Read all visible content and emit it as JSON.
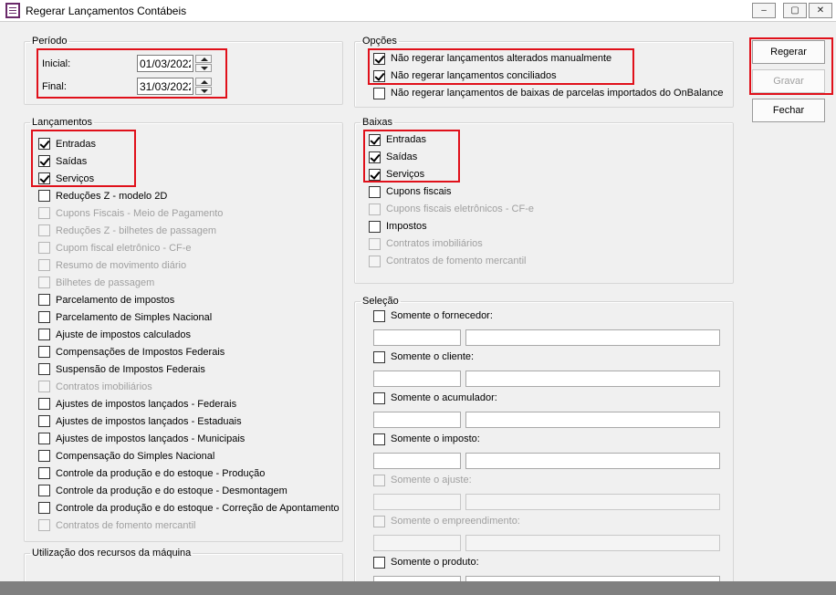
{
  "window": {
    "title": "Regerar Lançamentos Contábeis",
    "controls": {
      "minimize": "‒",
      "restore": "▢",
      "close": "✕"
    }
  },
  "buttons": {
    "regerar": "Regerar",
    "gravar": "Gravar",
    "fechar": "Fechar"
  },
  "periodo": {
    "legend": "Período",
    "inicial_label": "Inicial:",
    "inicial_value": "01/03/2022",
    "final_label": "Final:",
    "final_value": "31/03/2022"
  },
  "opcoes": {
    "legend": "Opções",
    "items": [
      {
        "label": "Não regerar lançamentos alterados manualmente",
        "checked": true,
        "enabled": true
      },
      {
        "label": "Não regerar lançamentos conciliados",
        "checked": true,
        "enabled": true
      },
      {
        "label": "Não regerar lançamentos de baixas de parcelas importados do OnBalance",
        "checked": false,
        "enabled": true
      }
    ]
  },
  "lancamentos": {
    "legend": "Lançamentos",
    "items": [
      {
        "label": "Entradas",
        "checked": true,
        "enabled": true
      },
      {
        "label": "Saídas",
        "checked": true,
        "enabled": true
      },
      {
        "label": "Serviços",
        "checked": true,
        "enabled": true
      },
      {
        "label": "Reduções Z - modelo 2D",
        "checked": false,
        "enabled": true
      },
      {
        "label": "Cupons Fiscais - Meio de Pagamento",
        "checked": false,
        "enabled": false
      },
      {
        "label": "Reduções Z - bilhetes de passagem",
        "checked": false,
        "enabled": false
      },
      {
        "label": "Cupom fiscal eletrônico - CF-e",
        "checked": false,
        "enabled": false
      },
      {
        "label": "Resumo de movimento diário",
        "checked": false,
        "enabled": false
      },
      {
        "label": "Bilhetes de passagem",
        "checked": false,
        "enabled": false
      },
      {
        "label": "Parcelamento de impostos",
        "checked": false,
        "enabled": true
      },
      {
        "label": "Parcelamento de Simples Nacional",
        "checked": false,
        "enabled": true
      },
      {
        "label": "Ajuste de impostos calculados",
        "checked": false,
        "enabled": true
      },
      {
        "label": "Compensações de Impostos Federais",
        "checked": false,
        "enabled": true
      },
      {
        "label": "Suspensão de Impostos Federais",
        "checked": false,
        "enabled": true
      },
      {
        "label": "Contratos imobiliários",
        "checked": false,
        "enabled": false
      },
      {
        "label": "Ajustes de impostos lançados - Federais",
        "checked": false,
        "enabled": true
      },
      {
        "label": "Ajustes de impostos lançados - Estaduais",
        "checked": false,
        "enabled": true
      },
      {
        "label": "Ajustes de impostos lançados - Municipais",
        "checked": false,
        "enabled": true
      },
      {
        "label": "Compensação do Simples Nacional",
        "checked": false,
        "enabled": true
      },
      {
        "label": "Controle da produção e do estoque - Produção",
        "checked": false,
        "enabled": true
      },
      {
        "label": "Controle da produção e do estoque - Desmontagem",
        "checked": false,
        "enabled": true
      },
      {
        "label": "Controle da produção e do estoque - Correção de Apontamento",
        "checked": false,
        "enabled": true
      },
      {
        "label": "Contratos de fomento mercantil",
        "checked": false,
        "enabled": false
      }
    ]
  },
  "baixas": {
    "legend": "Baixas",
    "items": [
      {
        "label": "Entradas",
        "checked": true,
        "enabled": true
      },
      {
        "label": "Saídas",
        "checked": true,
        "enabled": true
      },
      {
        "label": "Serviços",
        "checked": true,
        "enabled": true
      },
      {
        "label": "Cupons fiscais",
        "checked": false,
        "enabled": true
      },
      {
        "label": "Cupons fiscais eletrônicos - CF-e",
        "checked": false,
        "enabled": false
      },
      {
        "label": "Impostos",
        "checked": false,
        "enabled": true
      },
      {
        "label": "Contratos imobiliários",
        "checked": false,
        "enabled": false
      },
      {
        "label": "Contratos de fomento mercantil",
        "checked": false,
        "enabled": false
      }
    ]
  },
  "selecao": {
    "legend": "Seleção",
    "items": [
      {
        "label": "Somente o fornecedor:",
        "checked": false,
        "enabled": true
      },
      {
        "label": "Somente o cliente:",
        "checked": false,
        "enabled": true
      },
      {
        "label": "Somente o acumulador:",
        "checked": false,
        "enabled": true
      },
      {
        "label": "Somente o imposto:",
        "checked": false,
        "enabled": true
      },
      {
        "label": "Somente o ajuste:",
        "checked": false,
        "enabled": false
      },
      {
        "label": "Somente o empreendimento:",
        "checked": false,
        "enabled": false
      },
      {
        "label": "Somente o produto:",
        "checked": false,
        "enabled": true
      }
    ]
  },
  "recursos": {
    "legend": "Utilização dos recursos da máquina"
  },
  "colors": {
    "highlight": "#e0101a",
    "disabled_text": "#a0a0a0",
    "background": "#f0f0f0"
  }
}
